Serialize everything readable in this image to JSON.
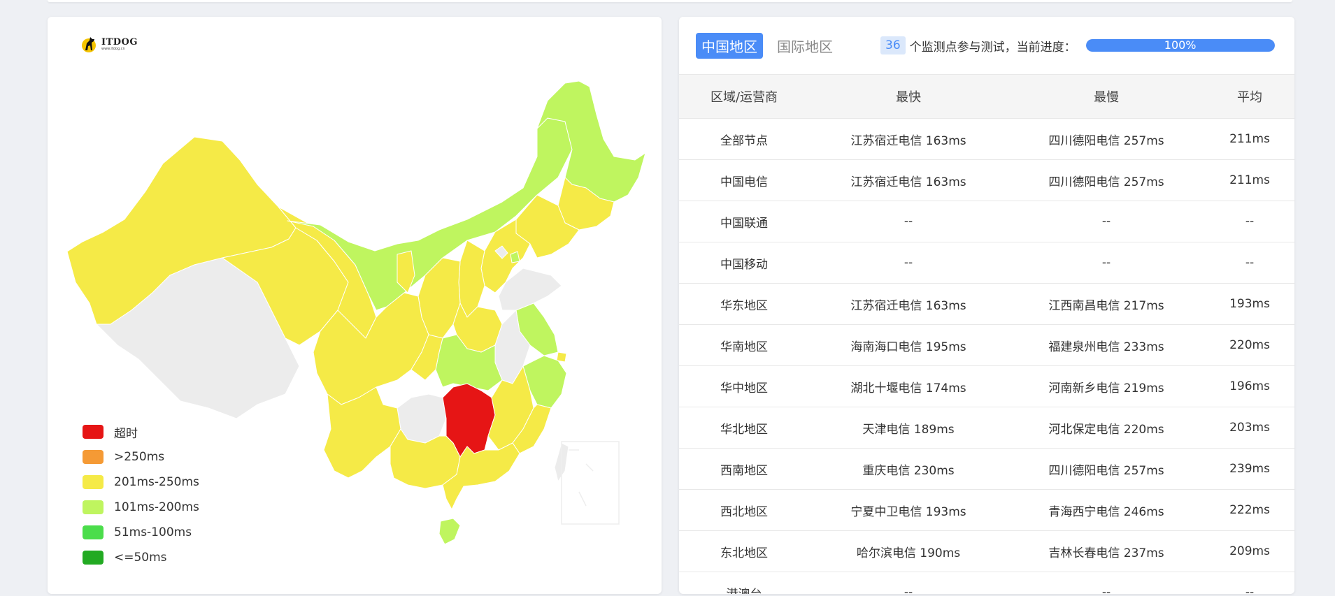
{
  "logo": {
    "text": "ITDOG",
    "sub": "www.itdog.cn"
  },
  "legend": [
    {
      "label": "超时",
      "color": "#e61515"
    },
    {
      "label": ">250ms",
      "color": "#f59a35"
    },
    {
      "label": "201ms-250ms",
      "color": "#f5ea47"
    },
    {
      "label": "101ms-200ms",
      "color": "#bff55f"
    },
    {
      "label": "51ms-100ms",
      "color": "#4bdd4b"
    },
    {
      "label": "<=50ms",
      "color": "#22aa22"
    }
  ],
  "tabs": {
    "domestic": "中国地区",
    "international": "国际地区"
  },
  "progress": {
    "count": "36",
    "label": "个监测点参与测试，当前进度：",
    "percent": 100,
    "percent_text": "100%"
  },
  "table": {
    "headers": [
      "区域/运营商",
      "最快",
      "最慢",
      "平均"
    ],
    "rows": [
      [
        "全部节点",
        "江苏宿迁电信 163ms",
        "四川德阳电信 257ms",
        "211ms"
      ],
      [
        "中国电信",
        "江苏宿迁电信 163ms",
        "四川德阳电信 257ms",
        "211ms"
      ],
      [
        "中国联通",
        "--",
        "--",
        "--"
      ],
      [
        "中国移动",
        "--",
        "--",
        "--"
      ],
      [
        "华东地区",
        "江苏宿迁电信 163ms",
        "江西南昌电信 217ms",
        "193ms"
      ],
      [
        "华南地区",
        "海南海口电信 195ms",
        "福建泉州电信 233ms",
        "220ms"
      ],
      [
        "华中地区",
        "湖北十堰电信 174ms",
        "河南新乡电信 219ms",
        "196ms"
      ],
      [
        "华北地区",
        "天津电信 189ms",
        "河北保定电信 220ms",
        "203ms"
      ],
      [
        "西南地区",
        "重庆电信 230ms",
        "四川德阳电信 257ms",
        "239ms"
      ],
      [
        "西北地区",
        "宁夏中卫电信 193ms",
        "青海西宁电信 246ms",
        "222ms"
      ],
      [
        "东北地区",
        "哈尔滨电信 190ms",
        "吉林长春电信 237ms",
        "209ms"
      ],
      [
        "港澳台",
        "--",
        "--",
        "--"
      ]
    ]
  }
}
